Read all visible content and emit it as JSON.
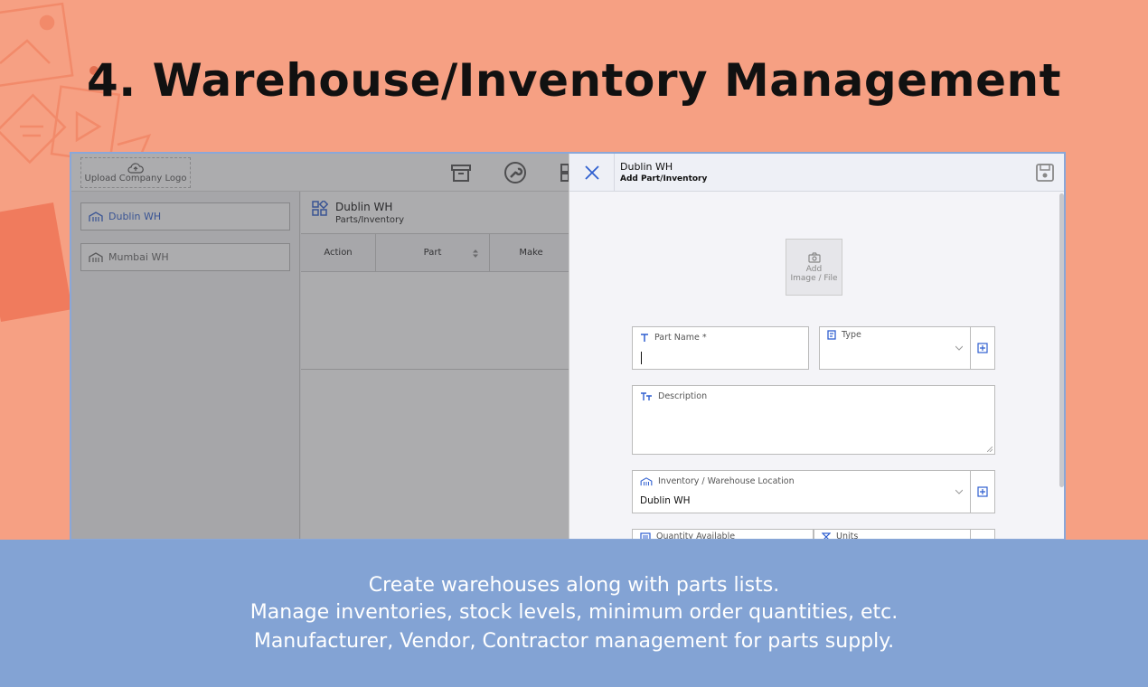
{
  "headline": "4. Warehouse/Inventory Management",
  "topbar": {
    "upload_logo_label": "Upload Company Logo"
  },
  "sidebar": {
    "items": [
      {
        "label": "Dublin WH"
      },
      {
        "label": "Mumbai WH"
      }
    ]
  },
  "main": {
    "title": "Dublin WH",
    "subtitle": "Parts/Inventory",
    "columns": [
      "Action",
      "Part",
      "Make"
    ]
  },
  "panel": {
    "title": "Dublin WH",
    "subtitle": "Add Part/Inventory",
    "add_image_line1": "Add",
    "add_image_line2": "Image / File",
    "fields": {
      "part_name_label": "Part Name *",
      "type_label": "Type",
      "description_label": "Description",
      "location_label": "Inventory / Warehouse Location",
      "location_value": "Dublin WH",
      "quantity_label": "Quantity Available",
      "units_label": "Units"
    }
  },
  "captions": [
    "Create warehouses along with parts lists.",
    "Manage inventories, stock levels, minimum order quantities, etc.",
    "Manufacturer, Vendor, Contractor management for parts supply."
  ],
  "colors": {
    "background": "#f6a083",
    "band": "#83a3d4",
    "accent": "#2f5fd0"
  }
}
